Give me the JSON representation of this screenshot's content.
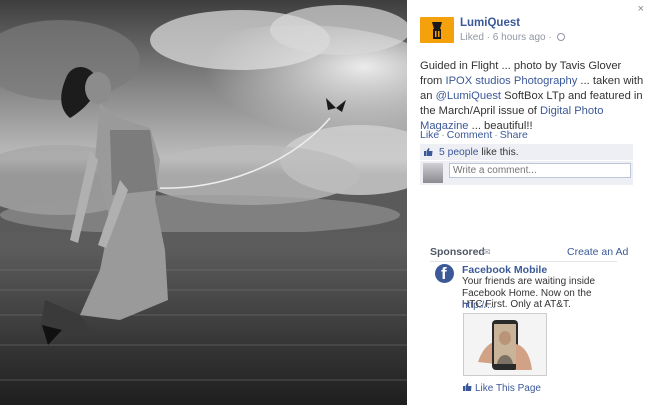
{
  "post": {
    "page_name": "LumiQuest",
    "meta_liked": "Liked",
    "meta_sep": " · ",
    "meta_time": "6 hours ago",
    "meta_sep2": " · ",
    "caption": {
      "part1": "Guided in Flight ... photo by Tavis Glover from ",
      "link1": "IPOX studios Photography",
      "part2": " ... taken with an ",
      "link2": "@LumiQuest",
      "part3": " SoftBox LTp and featured in the March/April issue of ",
      "link3": "Digital Photo Magazine",
      "part4": " ... beautiful!!"
    },
    "actions": {
      "like": "Like",
      "comment": "Comment",
      "share": "Share",
      "sep": "·"
    },
    "likes": {
      "count_text": "5 people",
      "suffix": " like this."
    },
    "comment_placeholder": "Write a comment..."
  },
  "close_label": "×",
  "sponsored": {
    "label": "Sponsored",
    "create_ad": "Create an Ad",
    "ad_title": "Facebook Mobile",
    "ad_body": "Your friends are waiting inside Facebook Home. Now on the HTC First. Only at AT&T.",
    "ad_url": "http://...",
    "like_page": "Like This Page"
  },
  "colors": {
    "fb_blue": "#3b5998",
    "logo_orange": "#f5a10b",
    "likes_bg": "#edeff4"
  },
  "icons": [
    "close-icon",
    "globe-icon",
    "like-thumb-icon",
    "sponsored-icon",
    "facebook-logo-icon",
    "butterfly-icon"
  ]
}
